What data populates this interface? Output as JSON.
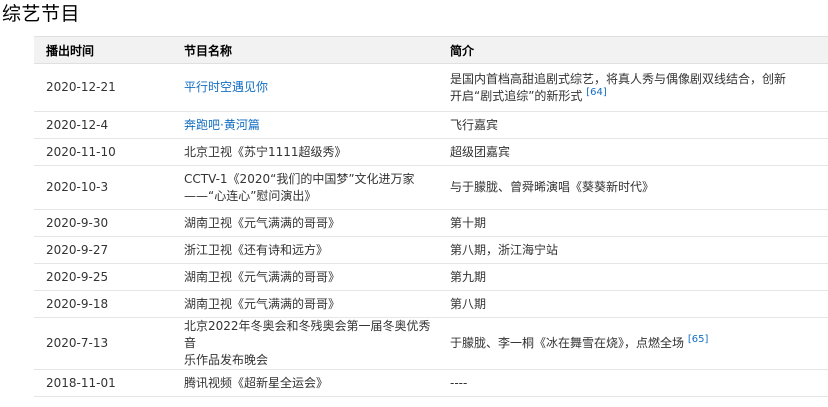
{
  "section": {
    "title": "综艺节目"
  },
  "table": {
    "headers": [
      "播出时间",
      "节目名称",
      "简介"
    ],
    "rows": [
      {
        "date": "2020-12-21",
        "program": "平行时空遇见你",
        "program_is_link": true,
        "desc_line1": "是国内首档高甜追剧式综艺，将真人秀与偶像剧双线结合，创新",
        "desc_line2": "开启“剧式追综”的新形式",
        "ref": "[64]"
      },
      {
        "date": "2020-12-4",
        "program": "奔跑吧·黄河篇",
        "program_is_link": true,
        "desc_line1": "飞行嘉宾",
        "desc_line2": "",
        "ref": ""
      },
      {
        "date": "2020-11-10",
        "program": "北京卫视《苏宁1111超级秀》",
        "program_is_link": false,
        "desc_line1": "超级团嘉宾",
        "desc_line2": "",
        "ref": ""
      },
      {
        "date": "2020-10-3",
        "program": "CCTV-1《2020“我们的中国梦”文化进万家",
        "program_line2": "——“心连心”慰问演出》",
        "program_is_link": false,
        "desc_line1": "与于朦胧、曾舜晞演唱《葵葵新时代》",
        "desc_line2": "",
        "ref": ""
      },
      {
        "date": "2020-9-30",
        "program": "湖南卫视《元气满满的哥哥》",
        "program_is_link": false,
        "desc_line1": "第十期",
        "desc_line2": "",
        "ref": ""
      },
      {
        "date": "2020-9-27",
        "program": "浙江卫视《还有诗和远方》",
        "program_is_link": false,
        "desc_line1": "第八期，浙江海宁站",
        "desc_line2": "",
        "ref": ""
      },
      {
        "date": "2020-9-25",
        "program": "湖南卫视《元气满满的哥哥》",
        "program_is_link": false,
        "desc_line1": "第九期",
        "desc_line2": "",
        "ref": ""
      },
      {
        "date": "2020-9-18",
        "program": "湖南卫视《元气满满的哥哥》",
        "program_is_link": false,
        "desc_line1": "第八期",
        "desc_line2": "",
        "ref": ""
      },
      {
        "date": "2020-7-13",
        "program": "北京2022年冬奥会和冬残奥会第一届冬奥优秀音",
        "program_line2": "乐作品发布晚会",
        "program_is_link": false,
        "desc_line1": "于朦胧、李一桐《冰在舞雪在烧》，点燃全场",
        "desc_line2": "",
        "ref": "[65]"
      },
      {
        "date": "2018-11-01",
        "program": "腾讯视频《超新星全运会》",
        "program_is_link": false,
        "desc_line1": "----",
        "desc_line2": "",
        "ref": ""
      }
    ]
  },
  "colors": {
    "link": "#136ec2",
    "header_bg": "#f2f2f2",
    "border": "#e6e6e6"
  }
}
